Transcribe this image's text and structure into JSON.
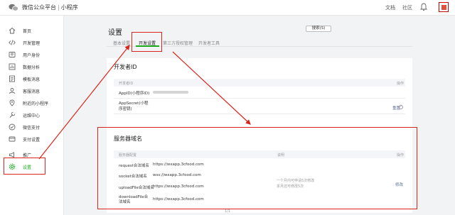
{
  "header": {
    "brand_main": "微信公众平台",
    "brand_sep": "|",
    "brand_sub": "小程序",
    "docs": "文档",
    "community": "社区"
  },
  "sidebar": {
    "items": [
      {
        "label": "首页",
        "icon": "home-icon"
      },
      {
        "label": "开发管理",
        "icon": "code-icon"
      },
      {
        "label": "用户身份",
        "icon": "user-icon"
      },
      {
        "label": "数据分析",
        "icon": "chart-icon"
      },
      {
        "label": "模板消息",
        "icon": "template-icon"
      },
      {
        "label": "客服消息",
        "icon": "service-icon"
      },
      {
        "label": "附近的小程序",
        "icon": "location-icon"
      },
      {
        "label": "运维中心",
        "icon": "wrench-icon"
      },
      {
        "label": "微信支付",
        "icon": "pay-icon"
      },
      {
        "label": "支付设置",
        "icon": "pay-settings-icon"
      },
      {
        "label": "推广",
        "icon": "promo-icon"
      },
      {
        "label": "设置",
        "icon": "gear-icon",
        "active": true
      }
    ]
  },
  "main": {
    "title": "设置",
    "search_button": "搜索(S)",
    "tabs": [
      "基本设置",
      "开发设置",
      "第三方授权管理",
      "开发者工具"
    ],
    "dev_id": {
      "title": "开发者ID",
      "col_name": "开发者ID",
      "col_action": "操作",
      "rows": [
        {
          "name": "AppID(小程序ID)",
          "action": ""
        },
        {
          "name": "AppSecret(小程序密钥)",
          "action": "重置"
        }
      ]
    },
    "server": {
      "title": "服务器域名",
      "col_config": "服务器配置",
      "col_desc": "说明",
      "col_action": "操作",
      "rows": [
        {
          "name": "request合法域名",
          "value": "https://wxapp.3cfood.com"
        },
        {
          "name": "socket合法域名",
          "value": "wss://wxapp.3cfood.com"
        },
        {
          "name": "uploadFile合法域名",
          "value": "https://wxapp.3cfood.com"
        },
        {
          "name": "downloadFile合法域名",
          "value": "https://wxapp.3cfood.com"
        }
      ],
      "desc_line1": "一个月内可申请5次修改",
      "desc_line2": "本月还可修改5次",
      "action": "修改"
    },
    "pager": "1/1"
  },
  "colors": {
    "accent": "#1aad19",
    "annotation": "#d9251b",
    "link": "#576b95"
  }
}
